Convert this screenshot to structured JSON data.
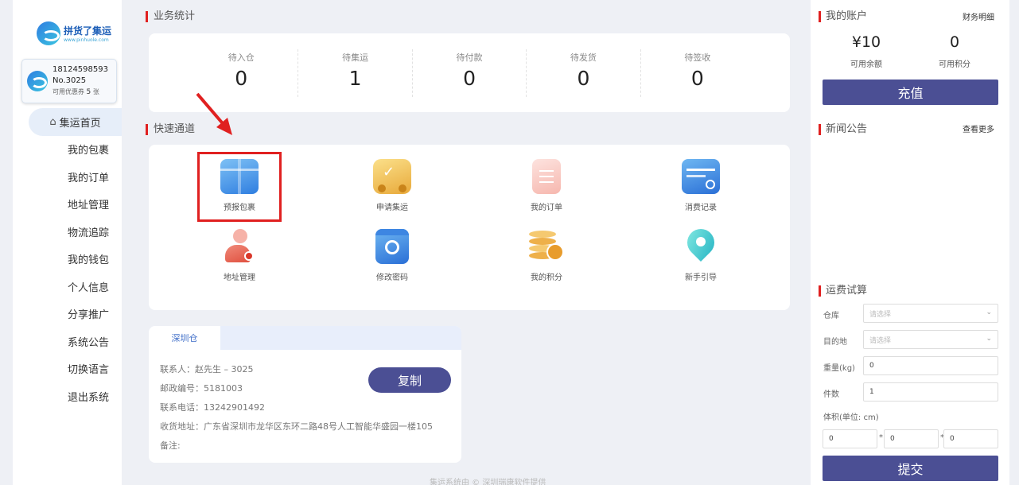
{
  "logo": {
    "cn": "拼货了集运",
    "en": "www.pinhuole.com"
  },
  "user": {
    "phone": "18124598593",
    "no": "No.3025",
    "coupon_prefix": "可用优惠券",
    "coupon_count": "5",
    "coupon_suffix": "张"
  },
  "nav": [
    "集运首页",
    "我的包裹",
    "我的订单",
    "地址管理",
    "物流追踪",
    "我的钱包",
    "个人信息",
    "分享推广",
    "系统公告",
    "切换语言",
    "退出系统"
  ],
  "stats": {
    "title": "业务统计",
    "items": [
      {
        "label": "待入仓",
        "value": "0"
      },
      {
        "label": "待集运",
        "value": "1"
      },
      {
        "label": "待付款",
        "value": "0"
      },
      {
        "label": "待发货",
        "value": "0"
      },
      {
        "label": "待签收",
        "value": "0"
      }
    ]
  },
  "quick": {
    "title": "快速通道",
    "items": [
      {
        "label": "预报包裹",
        "icon": "box-icon"
      },
      {
        "label": "申请集运",
        "icon": "truck-icon"
      },
      {
        "label": "我的订单",
        "icon": "clipboard-icon"
      },
      {
        "label": "消费记录",
        "icon": "card-icon"
      },
      {
        "label": "地址管理",
        "icon": "person-icon"
      },
      {
        "label": "修改密码",
        "icon": "gear-icon"
      },
      {
        "label": "我的积分",
        "icon": "coins-icon"
      },
      {
        "label": "新手引导",
        "icon": "location-pin-icon"
      }
    ]
  },
  "warehouse": {
    "tab": "深圳仓",
    "contact": "联系人：赵先生 – 3025",
    "postcode": "邮政编号：5181003",
    "phone": "联系电话：13242901492",
    "address": "收货地址：广东省深圳市龙华区东环二路48号人工智能华盛园一楼105",
    "note": "备注:",
    "copy_label": "复制"
  },
  "footer": "集运系统由 © 深圳瑞康软件提供",
  "account": {
    "title": "我的账户",
    "detail_link": "财务明细",
    "balance": "¥10",
    "balance_label": "可用余额",
    "points": "0",
    "points_label": "可用积分",
    "recharge": "充值"
  },
  "news": {
    "title": "新闻公告",
    "more": "查看更多"
  },
  "calc": {
    "title": "运费试算",
    "warehouse_label": "仓库",
    "warehouse_placeholder": "请选择",
    "dest_label": "目的地",
    "dest_placeholder": "请选择",
    "weight_label": "重量(kg)",
    "weight_value": "0",
    "count_label": "件数",
    "count_value": "1",
    "volume_label": "体积(单位: cm)",
    "len": "0",
    "wid": "0",
    "hei": "0",
    "times": "*",
    "submit": "提交"
  },
  "colors": {
    "accent": "#4b4f94",
    "red": "#e02020",
    "brand": "#1e5fb8"
  }
}
